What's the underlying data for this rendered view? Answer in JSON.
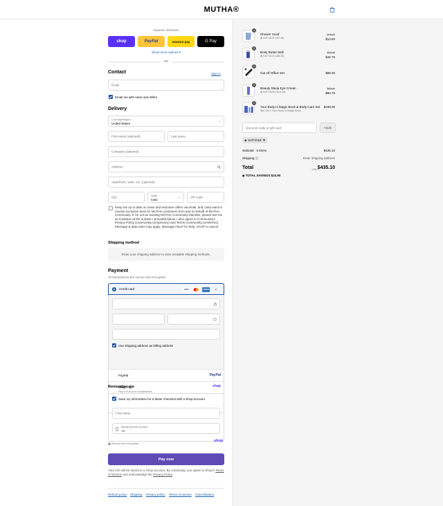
{
  "header": {
    "logo": "MUTHA®",
    "cart_icon": "shopping-bag-icon"
  },
  "express": {
    "title": "Express checkout",
    "shop": "shop",
    "paypal": "PayPal",
    "amazon": "amazon pay",
    "gpay": "G Pay",
    "more": "Show more options",
    "or": "OR"
  },
  "contact": {
    "title": "Contact",
    "sign_in": "Sign in",
    "email_placeholder": "Email",
    "news_label": "Email me with news and offers"
  },
  "delivery": {
    "title": "Delivery",
    "country_label": "Country/Region",
    "country_value": "United States",
    "first_name": "First name (optional)",
    "last_name": "Last name",
    "company": "Company (optional)",
    "address": "Address",
    "apartment": "Apartment, suite, etc. (optional)",
    "city": "City",
    "state_label": "State",
    "state_value": "Iowa",
    "zip": "ZIP code",
    "sms_consent": "Keep me up to date on news and exclusive offers via email, and I also want to receive exclusive texts for MUTHA customers from and on behalf of MUTHA Community. If I'm not an existing MUTHA Community Member, please text me an invitation at the number I provided below. I also agree to Community's Privacy Policy (community.com/privacy) and Terms (community.com/terms). Message & data rates may apply. Message HELP for help, STOP to cancel."
  },
  "shipping": {
    "title": "Shipping method",
    "notice": "Enter your shipping address to view available shipping methods."
  },
  "payment": {
    "title": "Payment",
    "subtitle": "All transactions are secure and encrypted.",
    "credit_card": "Credit card",
    "card_brands": [
      "VISA",
      "MC",
      "AMEX",
      "+5"
    ],
    "billing_label": "Use shipping address as billing address",
    "paypal_label": "PayPal",
    "paypal_logo": "PayPal",
    "shoppay_label": "Shop Pay",
    "shoppay_sub": "Pay in full or in installments",
    "shoppay_logo": "shop"
  },
  "remember": {
    "title": "Remember me",
    "save_label": "Save my information for a faster checkout with a Shop account",
    "first_name": "First name",
    "phone_label": "Mobile phone number",
    "phone_value": "+1",
    "secure": "Secure and encrypted",
    "shop_logo": "shop"
  },
  "pay_now": "Pay now",
  "legal": {
    "line1": "Your info will be saved to a Shop account. By continuing, you agree to Shop's",
    "terms": "Terms of Service",
    "and": "and acknowledge the",
    "privacy": "Privacy Policy",
    "end": "."
  },
  "footer_links": [
    "Refund policy",
    "Shipping",
    "Privacy policy",
    "Terms of service",
    "Cancellations"
  ],
  "cart": {
    "items": [
      {
        "qty": "1",
        "name": "Shower Scarf",
        "sub": "KATYA15 (-$2.40)",
        "old": "$16.00",
        "price": "$13.60",
        "color": "#8fa8d8"
      },
      {
        "qty": "1",
        "name": "Body Butter Mall",
        "sub": "KATYA15 (-$8.25)",
        "old": "$55.00",
        "price": "$46.75",
        "color": "#3e4fa8"
      },
      {
        "qty": "1",
        "name": "Out Of Office Set",
        "sub": "",
        "old": "",
        "price": "$95.00",
        "color": "#222"
      },
      {
        "qty": "1",
        "name": "Beauty Sleep Eye Cream",
        "sub": "KATYA15 (-$14.25)",
        "old": "$95.00",
        "price": "$80.75",
        "color": "#6b6cc0"
      },
      {
        "qty": "1",
        "name": "Your Body is Magic Book & Body Care Set",
        "sub": "5pc Set x Your Body is Magic Book",
        "old": "",
        "price": "$199.00",
        "color": "#4a63c6"
      }
    ],
    "discount_placeholder": "Discount code or gift card",
    "apply": "Apply",
    "code": "KATYA15",
    "subtotal_label": "Subtotal · 5 items",
    "subtotal": "$435.10",
    "shipping_label": "Shipping",
    "shipping_value": "Enter shipping address",
    "total_label": "Total",
    "currency": "USD",
    "total": "$435.10",
    "savings_label": "TOTAL SAVINGS",
    "savings": "$24.90"
  }
}
